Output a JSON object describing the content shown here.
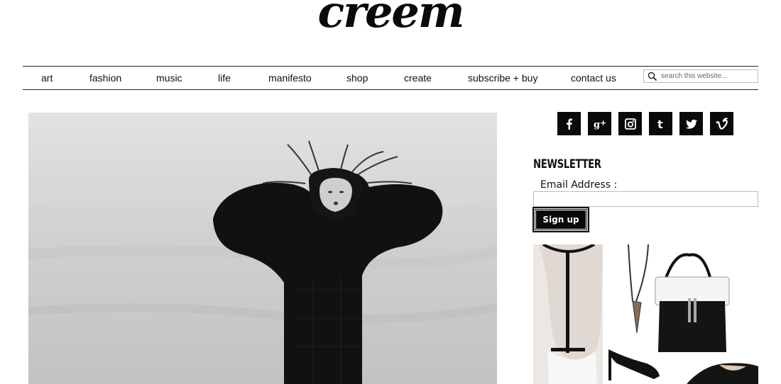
{
  "site": {
    "logo": "creem"
  },
  "nav": {
    "items": [
      {
        "label": "art"
      },
      {
        "label": "fashion"
      },
      {
        "label": "music"
      },
      {
        "label": "life"
      },
      {
        "label": "manifesto"
      },
      {
        "label": "shop"
      },
      {
        "label": "create"
      },
      {
        "label": "subscribe + buy"
      },
      {
        "label": "contact us"
      }
    ],
    "search_placeholder": "search this website..."
  },
  "social": {
    "icons": [
      "facebook-icon",
      "google-plus-icon",
      "instagram-icon",
      "tumblr-icon",
      "twitter-icon",
      "vimeo-icon"
    ]
  },
  "newsletter": {
    "title": "NEWSLETTER",
    "email_label": "Email Address :",
    "email_value": "",
    "button_label": "Sign up"
  }
}
